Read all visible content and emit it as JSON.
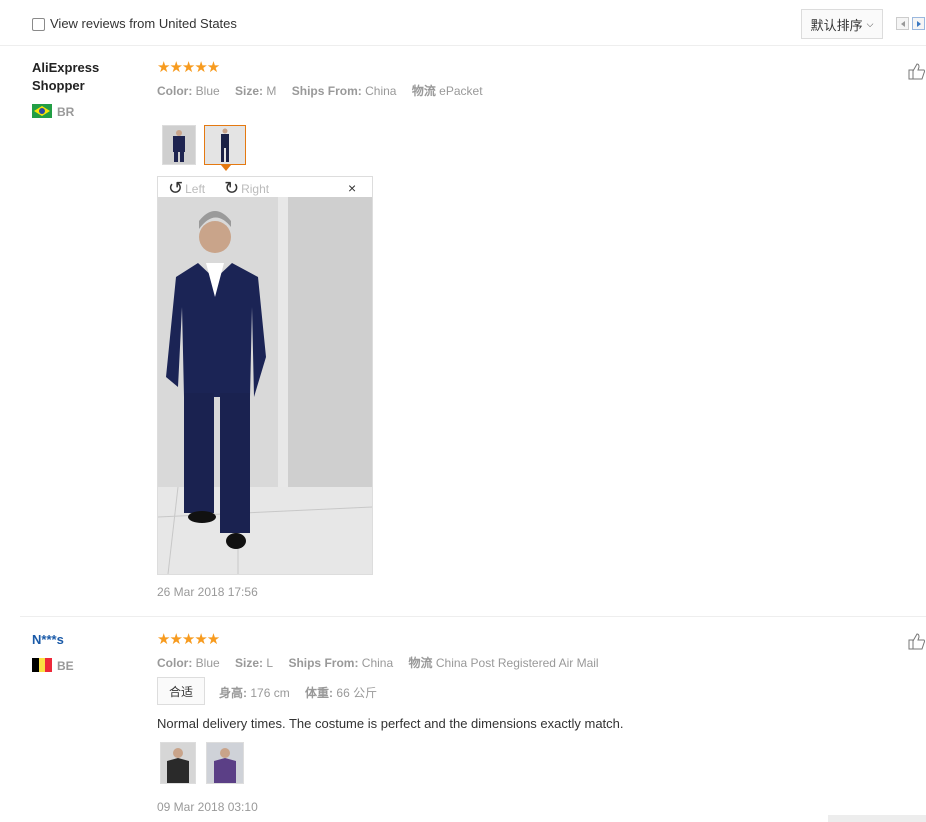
{
  "filter": {
    "label": "View reviews from United States",
    "sort_label": "默认排序"
  },
  "reviews": [
    {
      "user_line1": "AliExpress",
      "user_line2": "Shopper",
      "country": "BR",
      "stars": "★★★★★",
      "color_label": "Color:",
      "color_value": "Blue",
      "size_label": "Size:",
      "size_value": "M",
      "ships_label": "Ships From:",
      "ships_value": "China",
      "logistics_label": "物流",
      "logistics_value": "ePacket",
      "viewer": {
        "left_label": "Left",
        "right_label": "Right",
        "close": "×"
      },
      "date": "26 Mar 2018 17:56"
    },
    {
      "user": "N***s",
      "country": "BE",
      "stars": "★★★★★",
      "color_label": "Color:",
      "color_value": "Blue",
      "size_label": "Size:",
      "size_value": "L",
      "ships_label": "Ships From:",
      "ships_value": "China",
      "logistics_label": "物流",
      "logistics_value": "China Post Registered Air Mail",
      "fit": "合适",
      "height_label": "身高:",
      "height_value": "176 cm",
      "weight_label": "体重:",
      "weight_value": "66 公斤",
      "text": "Normal delivery times. The costume is perfect and the dimensions exactly match.",
      "date": "09 Mar 2018 03:10"
    }
  ],
  "colors": {
    "star": "#f79b1f",
    "accent": "#e47911",
    "link": "#1a5aa8"
  }
}
